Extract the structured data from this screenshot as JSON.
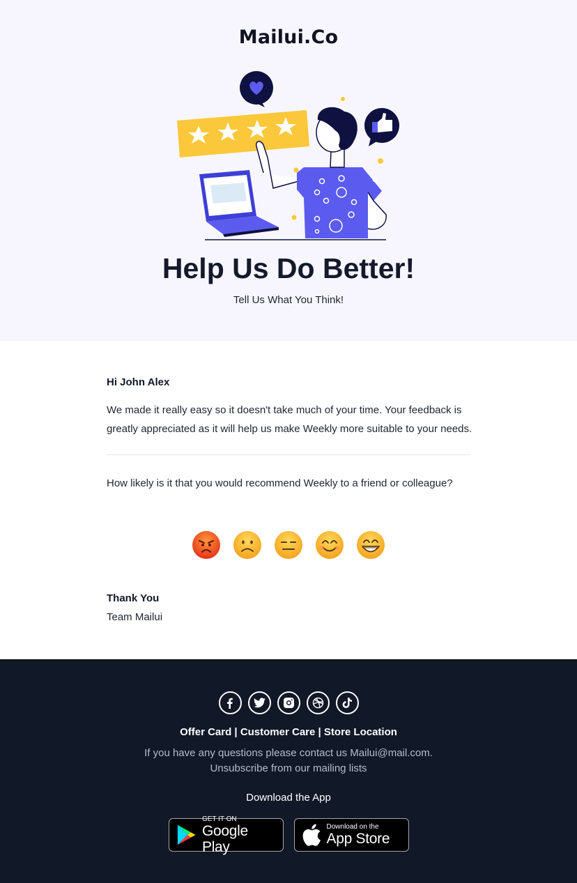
{
  "header": {
    "brand": "Mailui.Co",
    "headline": "Help Us Do Better!",
    "subheadline": "Tell Us What You Think!",
    "illustration": "person-rating-stars-illustration"
  },
  "body": {
    "greeting": "Hi John Alex",
    "message": "We made it really easy so it doesn't take much of your time. Your feedback is greatly appreciated as it will help us make Weekly more suitable to your needs.",
    "question": "How likely is it that you would recommend Weekly to a friend or colleague?",
    "ratings": [
      {
        "name": "angry",
        "glyph": "😡"
      },
      {
        "name": "sad",
        "glyph": "🙁"
      },
      {
        "name": "neutral",
        "glyph": "😑"
      },
      {
        "name": "happy",
        "glyph": "😊"
      },
      {
        "name": "very-happy",
        "glyph": "😁"
      }
    ],
    "signoff": "Thank You",
    "signature": "Team Mailui"
  },
  "footer": {
    "socials": [
      "facebook",
      "twitter",
      "instagram",
      "dribbble",
      "tiktok"
    ],
    "links": [
      "Offer Card",
      "Customer Care",
      "Store Location"
    ],
    "separator": " | ",
    "contact_text": "If you have any questions please contact us Mailui@mail.com. Unsubscribe from our mailing lists",
    "download_title": "Download the App",
    "google_play": {
      "small": "GET IT ON",
      "big": "Google Play"
    },
    "app_store": {
      "small": "Download on the",
      "big": "App Store"
    }
  },
  "colors": {
    "hero_bg": "#f7f6fe",
    "footer_bg": "#111827",
    "accent_purple": "#5b5bf0",
    "accent_yellow": "#fcc83b",
    "navy": "#0f1140"
  }
}
